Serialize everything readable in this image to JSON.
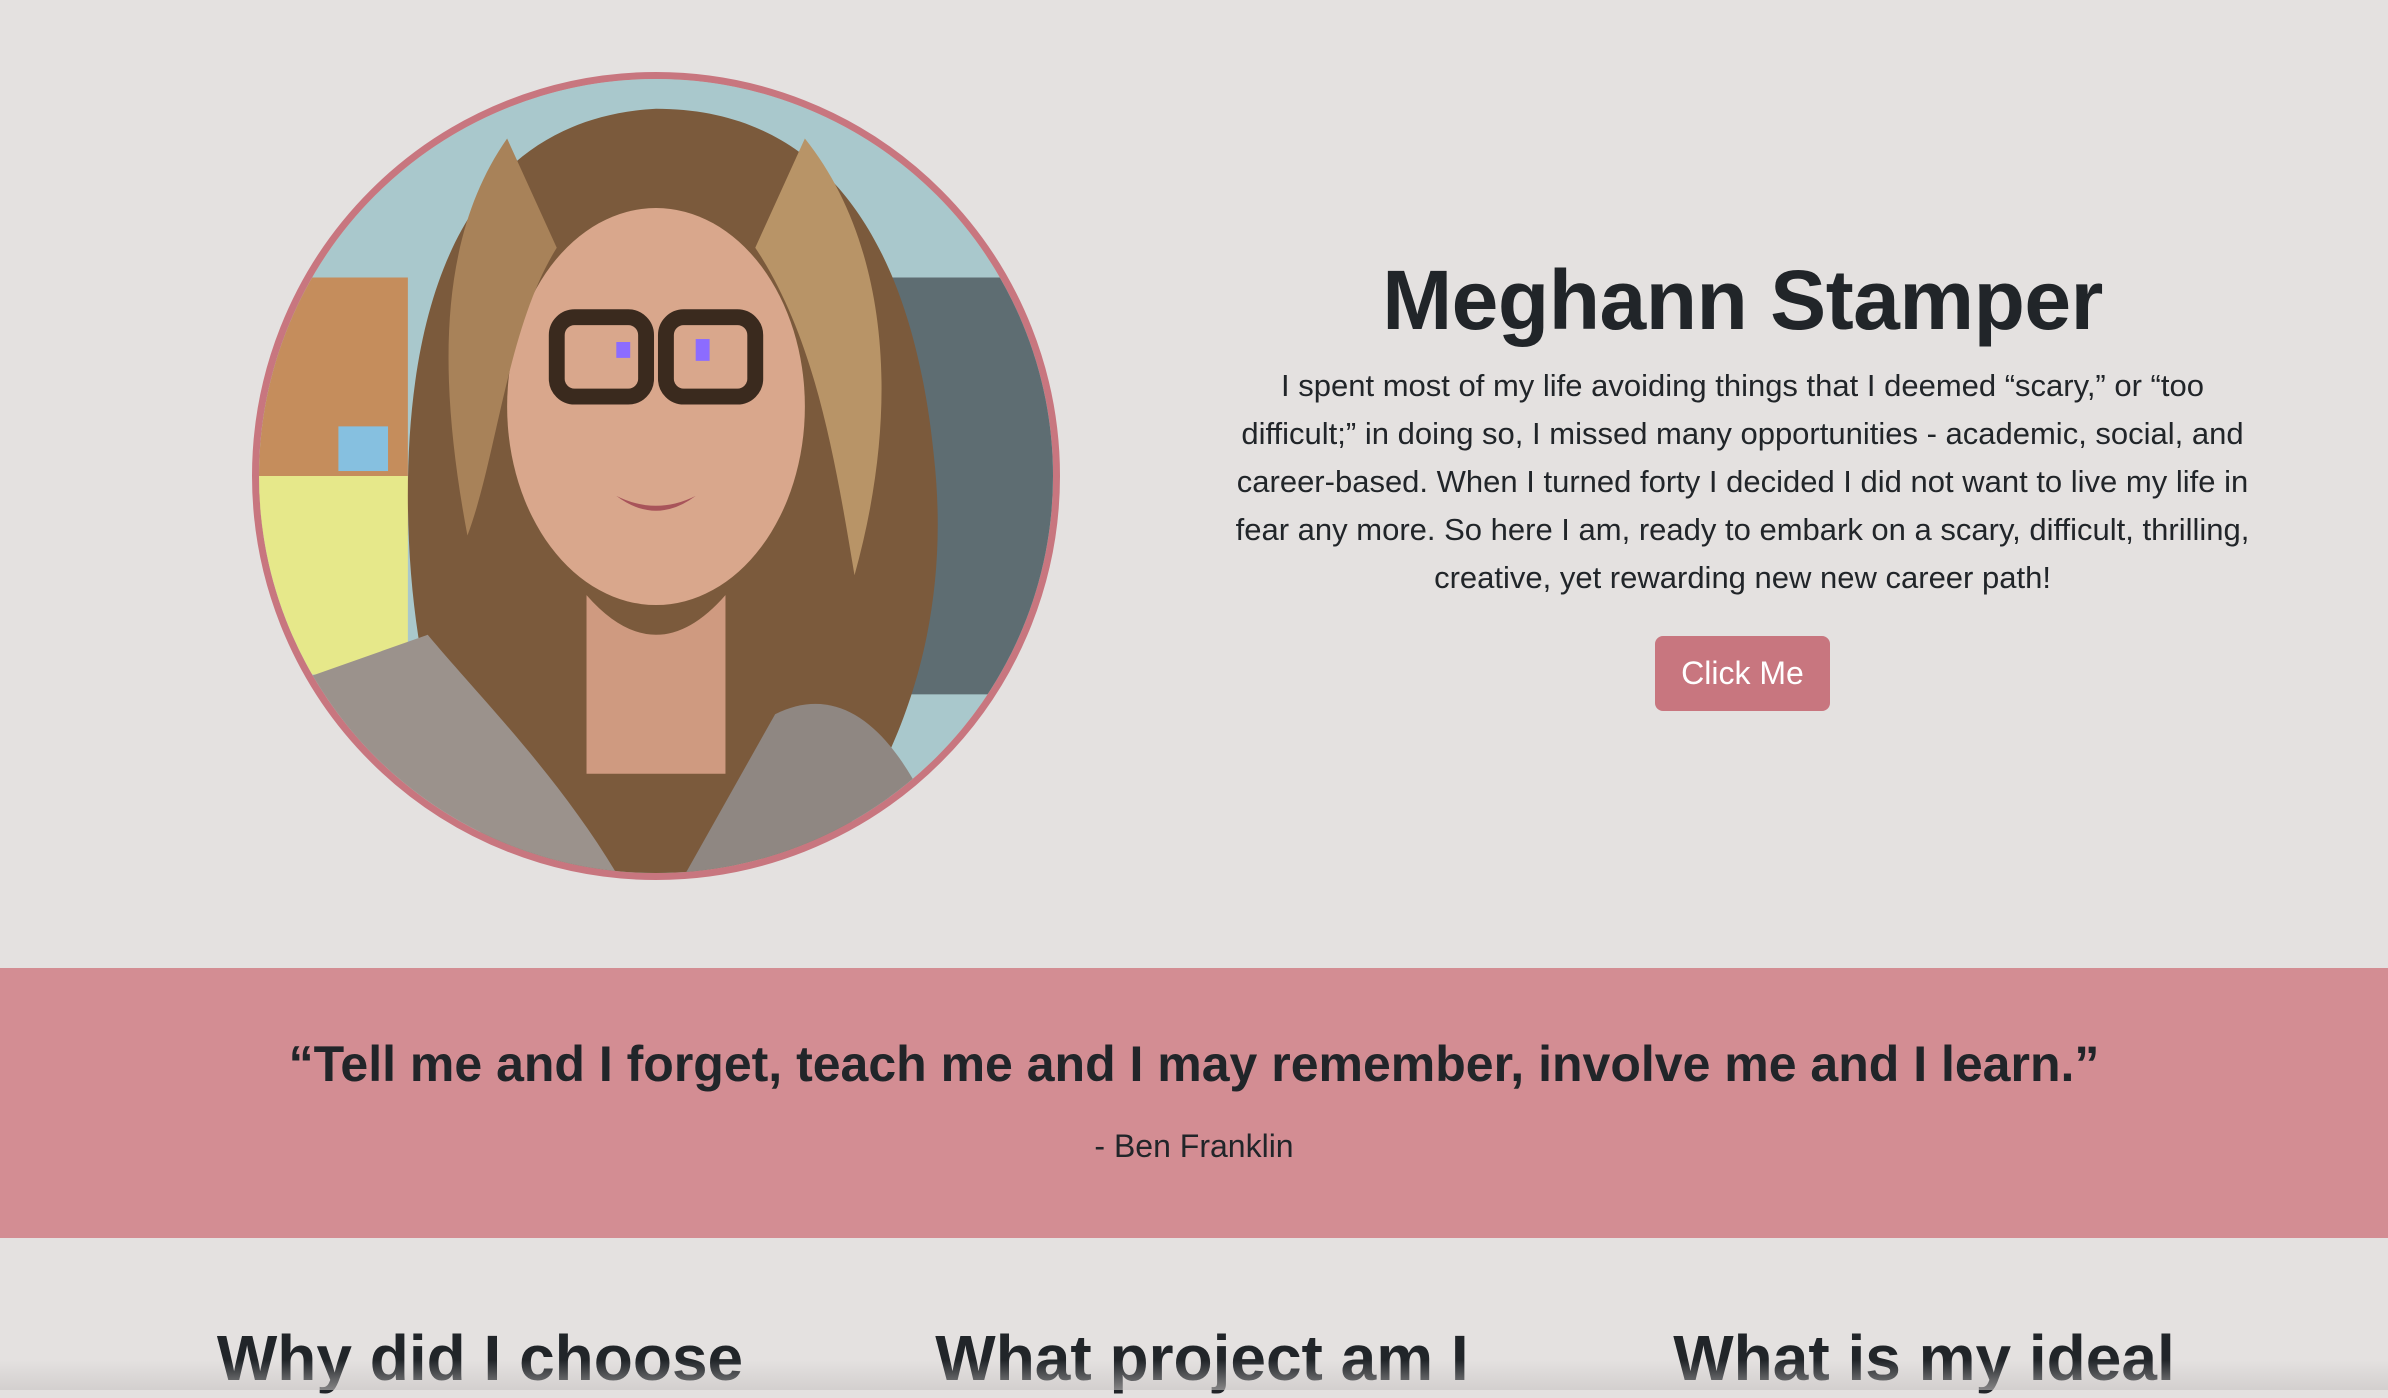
{
  "profile": {
    "name": "Meghann Stamper",
    "bio": "I spent most of my life avoiding things that I deemed “scary,” or “too difficult;” in doing so, I missed many opportunities - academic, social, and career-based. When I turned forty I decided I did not want to live my life in fear any more. So here I am, ready to embark on a scary, difficult, thrilling, creative, yet rewarding new new career path!",
    "cta_label": "Click Me",
    "photo_icon": "profile-photo"
  },
  "quote": {
    "text": "“Tell me and I forget, teach me and I may remember, involve me and I learn.”",
    "author": "- Ben Franklin"
  },
  "features": [
    {
      "title": "Why did I choose"
    },
    {
      "title": "What project am I"
    },
    {
      "title": "What is my ideal"
    }
  ],
  "colors": {
    "background": "#e4e1e0",
    "accent": "#c8767f",
    "quote_band": "#d38d93",
    "text": "#212529"
  }
}
